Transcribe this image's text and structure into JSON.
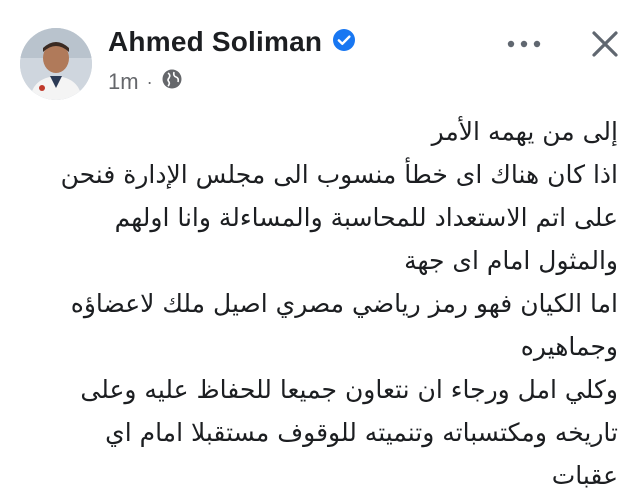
{
  "post": {
    "author": "Ahmed Soliman",
    "time": "1m",
    "separator": "·",
    "icons": {
      "verified": "verified-badge-icon",
      "audience": "globe-icon",
      "more": "more-options-icon",
      "close": "close-icon"
    },
    "colors": {
      "verified_badge": "#1877f2",
      "text": "#1c1e21",
      "secondary_text": "#65676b",
      "icon": "#606770"
    },
    "lines": [
      "إلى من يهمه الأمر",
      "اذا كان هناك اى خطأ منسوب الى مجلس الإدارة فنحن",
      "على اتم الاستعداد للمحاسبة والمساءلة وانا اولهم",
      "والمثول امام اى جهة",
      "اما الكيان فهو  رمز رياضي مصري اصيل ملك لاعضاؤه",
      "وجماهيره",
      "وكلي امل ورجاء ان نتعاون جميعا للحفاظ عليه وعلى",
      "تاريخه ومكتسباته وتنميته للوقوف مستقبلا امام اي",
      "عقبات"
    ]
  }
}
